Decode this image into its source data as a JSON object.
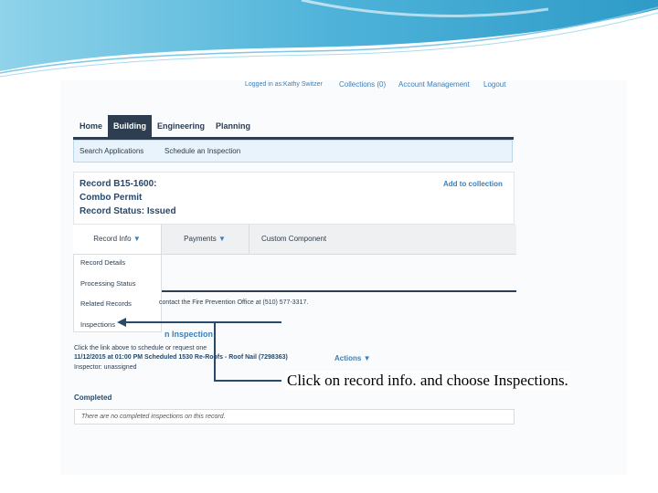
{
  "header": {
    "logged_in": "Logged in as:Kathy Switzer",
    "collections": "Collections (0)",
    "account": "Account Management",
    "logout": "Logout"
  },
  "nav": {
    "tabs": [
      "Home",
      "Building",
      "Engineering",
      "Planning"
    ],
    "active": "Building"
  },
  "subnav": {
    "items": [
      "Search Applications",
      "Schedule an Inspection"
    ]
  },
  "record": {
    "number": "Record B15-1600:",
    "type": "Combo Permit",
    "status": "Record Status: Issued",
    "add_collection": "Add to collection"
  },
  "tabs": {
    "record_info": "Record Info",
    "payments": "Payments",
    "custom": "Custom Component"
  },
  "menu": {
    "items": [
      "Record Details",
      "Processing Status",
      "Related Records",
      "Inspections"
    ]
  },
  "content": {
    "fire_notice": "contact the Fire Prevention Office at (510) 577-3317.",
    "inspection_heading": "n Inspection",
    "click_link": "Click the link above to schedule or request one",
    "scheduled": "11/12/2015 at 01:00 PM Scheduled 1530 Re-Roofs - Roof Nail (7298363)",
    "actions": "Actions",
    "inspector": "Inspector: unassigned",
    "completed": "Completed",
    "no_completed": "There are no completed inspections on this record."
  },
  "callout": {
    "text": "Click on record info. and choose Inspections."
  },
  "colors": {
    "nav_dark": "#2c3e50",
    "link_blue": "#3d7fb8",
    "subnav_bg": "#e8f3fb",
    "swoosh": "#4fb3d9"
  },
  "icons": [
    "dropdown-triangle-icon",
    "arrow-left-icon"
  ]
}
